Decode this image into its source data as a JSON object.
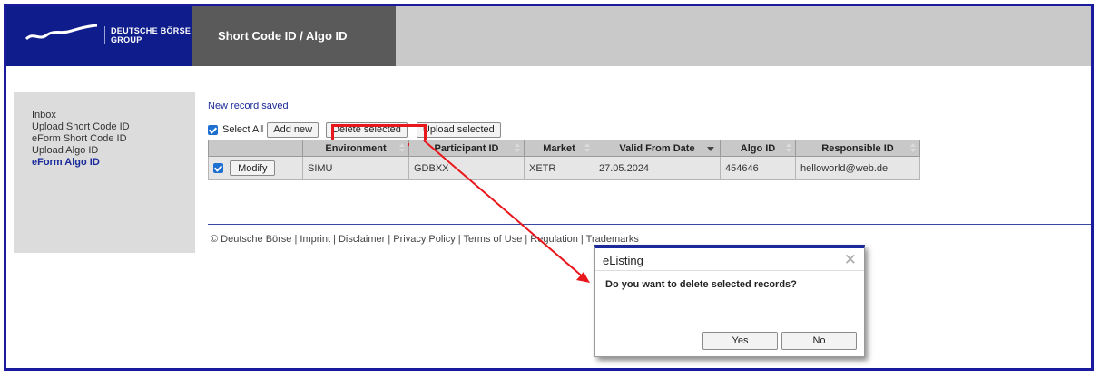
{
  "header": {
    "logo_line1": "DEUTSCHE BÖRSE",
    "logo_line2": "GROUP",
    "title": "Short Code ID / Algo ID"
  },
  "sidebar": {
    "items": [
      {
        "label": "Inbox",
        "active": false
      },
      {
        "label": "Upload Short Code ID",
        "active": false
      },
      {
        "label": "eForm Short Code ID",
        "active": false
      },
      {
        "label": "Upload Algo ID",
        "active": false
      },
      {
        "label": "eForm Algo ID",
        "active": true
      }
    ]
  },
  "main": {
    "status_message": "New record saved",
    "toolbar": {
      "select_all_label": "Select All",
      "add_new_label": "Add new",
      "delete_selected_label": "Delete selected",
      "upload_selected_label": "Upload selected"
    },
    "table": {
      "columns": [
        "Environment",
        "Participant ID",
        "Market",
        "Valid From Date",
        "Algo ID",
        "Responsible ID"
      ],
      "rows": [
        {
          "action_label": "Modify",
          "environment": "SIMU",
          "participant_id": "GDBXX",
          "market": "XETR",
          "valid_from_date": "27.05.2024",
          "algo_id": "454646",
          "responsible_id": "helloworld@web.de"
        }
      ]
    }
  },
  "footer": {
    "text": "© Deutsche Börse | Imprint | Disclaimer | Privacy Policy | Terms of Use | Regulation | Trademarks"
  },
  "dialog": {
    "title": "eListing",
    "message": "Do you want to delete selected records?",
    "yes_label": "Yes",
    "no_label": "No"
  },
  "colors": {
    "brand_blue": "#0f1d8c",
    "highlight_red": "#e8171c"
  }
}
